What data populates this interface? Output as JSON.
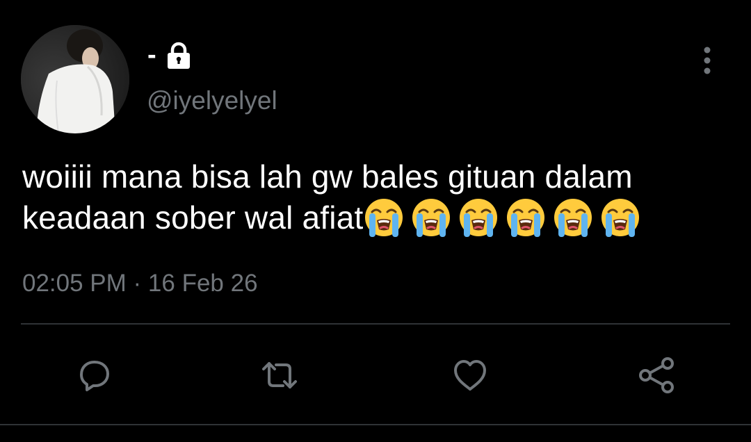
{
  "tweet": {
    "display_name": "-",
    "handle": "@iyelyelyel",
    "text_line1": "woiiii mana bisa lah gw bales gituan dalam",
    "text_line2": "keadaan sober wal afiat",
    "emoji": [
      "loudly-crying-face",
      "loudly-crying-face",
      "loudly-crying-face",
      "loudly-crying-face",
      "loudly-crying-face",
      "loudly-crying-face"
    ],
    "timestamp": "02:05 PM · 16 Feb 26"
  },
  "icons": {
    "lock": "lock-icon",
    "more": "more-vertical-icon",
    "reply": "reply-icon",
    "retweet": "retweet-icon",
    "like": "heart-icon",
    "share": "share-icon"
  },
  "colors": {
    "background": "#000000",
    "primary_text": "#ffffff",
    "secondary_text": "#71767b",
    "divider": "#2f3336",
    "emoji_face": "#ffcb3d",
    "emoji_tears": "#5fb4f0"
  }
}
